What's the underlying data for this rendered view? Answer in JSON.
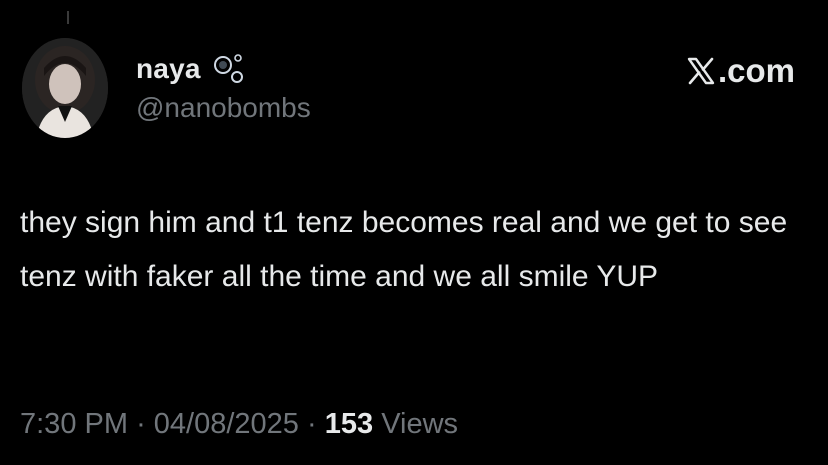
{
  "author": {
    "display_name": "naya",
    "handle": "@nanobombs",
    "avatar_icon": "profile-photo",
    "badge_icon": "bubbles-icon"
  },
  "brand": {
    "text": ".com",
    "logo_icon": "x-logo-icon"
  },
  "tweet": {
    "text": "they sign him and t1 tenz becomes real and we get to see tenz with faker all the time and we all smile YUP"
  },
  "meta": {
    "time": "7:30 PM",
    "separator": "·",
    "date": "04/08/2025",
    "views_count": "153",
    "views_label": "Views"
  },
  "colors": {
    "background": "#000000",
    "primary_text": "#e7e9ea",
    "secondary_text": "#71767b"
  }
}
